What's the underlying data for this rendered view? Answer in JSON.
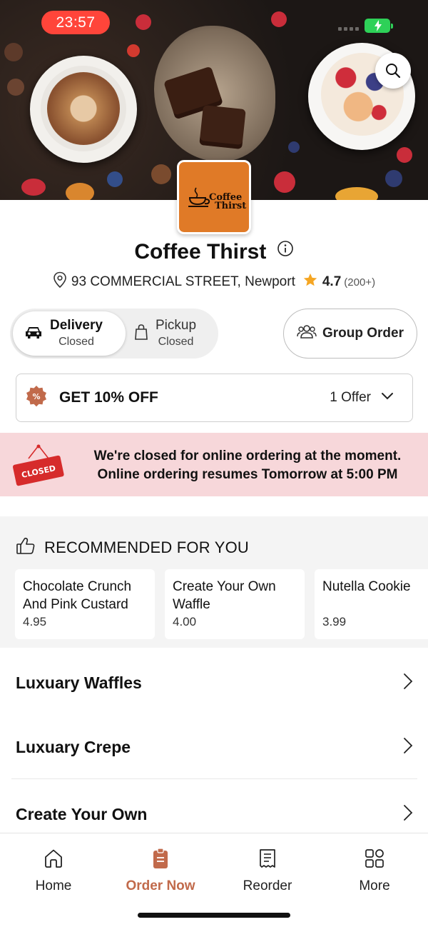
{
  "status_bar": {
    "time": "23:57"
  },
  "store": {
    "name": "Coffee Thirst",
    "logo_line1": "Coffee",
    "logo_line2": "Thirst",
    "address": "93 COMMERCIAL STREET, Newport",
    "rating": "4.7",
    "review_count": "(200+)"
  },
  "modes": {
    "delivery": {
      "label": "Delivery",
      "status": "Closed",
      "selected": true
    },
    "pickup": {
      "label": "Pickup",
      "status": "Closed",
      "selected": false
    }
  },
  "group_order_label": "Group Order",
  "offer": {
    "title": "GET 10% OFF",
    "count": "1 Offer"
  },
  "closed_notice": {
    "sign_text": "CLOSED",
    "line1": "We're closed for online ordering at the moment.",
    "line2": "Online ordering resumes Tomorrow at 5:00 PM"
  },
  "recommended": {
    "title": "RECOMMENDED FOR YOU",
    "items": [
      {
        "name": "Chocolate Crunch And Pink Custard",
        "price": "4.95"
      },
      {
        "name": "Create Your Own Waffle",
        "price": "4.00"
      },
      {
        "name": "Nutella Cookie",
        "price": "3.99"
      }
    ]
  },
  "categories": [
    "Luxuary Waffles",
    "Luxuary Crepe",
    "Create Your Own"
  ],
  "tab_bar": {
    "tabs": [
      {
        "label": "Home",
        "icon": "home-icon"
      },
      {
        "label": "Order Now",
        "icon": "order-icon",
        "active": true
      },
      {
        "label": "Reorder",
        "icon": "receipt-icon"
      },
      {
        "label": "More",
        "icon": "grid-icon"
      }
    ]
  },
  "colors": {
    "accent": "#c16a4b",
    "logo_bg": "#e07a27",
    "closed_banner_bg": "#f7d7da",
    "status_time_bg": "#ff453a",
    "battery": "#2ed158",
    "star": "#f5a623",
    "closed_sign": "#d62b2b"
  }
}
